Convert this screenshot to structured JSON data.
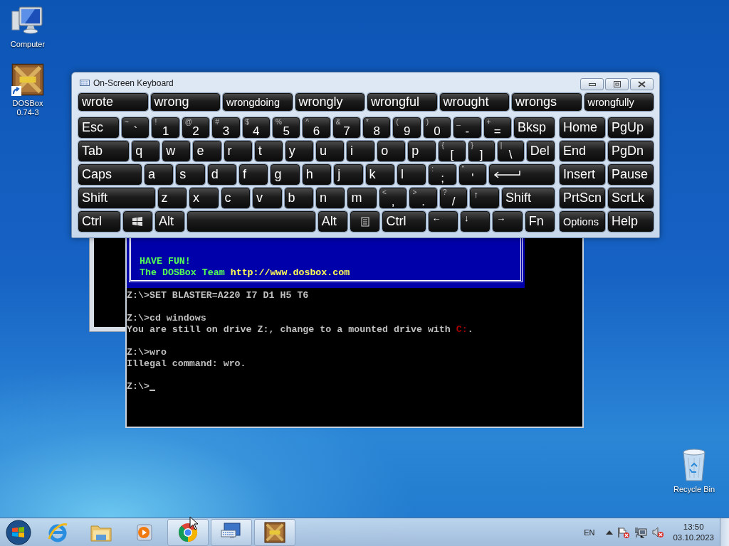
{
  "desktop_icons": [
    {
      "kind": "computer",
      "label": "Computer"
    },
    {
      "kind": "dosbox",
      "label": "DOSBox 0.74-3"
    }
  ],
  "recycle_bin": {
    "label": "Recycle Bin"
  },
  "dosbox_console": {
    "banner": [
      {
        "color": "#55ff55",
        "segments": [
          {
            "text": "HAVE FUN!"
          }
        ]
      },
      {
        "color": "#55ff55",
        "segments": [
          {
            "text": "The DOSBox Team "
          },
          {
            "text": "http://www.dosbox.com",
            "color": "#ffff55"
          }
        ]
      }
    ],
    "groups": [
      [
        {
          "color": "#c0c0c0",
          "segments": [
            {
              "text": "Z:\\>SET BLASTER=A220 I7 D1 H5 T6"
            }
          ]
        }
      ],
      [
        {
          "color": "#c0c0c0",
          "segments": [
            {
              "text": "Z:\\>cd windows"
            }
          ]
        },
        {
          "color": "#c0c0c0",
          "segments": [
            {
              "text": "You are still on drive Z:, change to a mounted drive with "
            },
            {
              "text": "C:",
              "color": "#aa0000"
            },
            {
              "text": "."
            }
          ]
        }
      ],
      [
        {
          "color": "#c0c0c0",
          "segments": [
            {
              "text": "Z:\\>wro"
            }
          ]
        },
        {
          "color": "#c0c0c0",
          "segments": [
            {
              "text": "Illegal command: wro."
            }
          ]
        }
      ],
      [
        {
          "color": "#c0c0c0",
          "segments": [
            {
              "text": "Z:\\>"
            }
          ]
        }
      ]
    ]
  },
  "keyboard": {
    "title": "On-Screen Keyboard",
    "predictions": [
      "wrote",
      "wrong",
      "wrongdoing",
      "wrongly",
      "wrongful",
      "wrought",
      "wrongs",
      "wrongfully"
    ],
    "key_rows": [
      {
        "keys": [
          {
            "kind": "text",
            "label": "Esc"
          },
          {
            "kind": "char",
            "shift": "~",
            "label": "`"
          },
          {
            "kind": "char",
            "shift": "!",
            "label": "1"
          },
          {
            "kind": "char",
            "shift": "@",
            "label": "2"
          },
          {
            "kind": "char",
            "shift": "#",
            "label": "3"
          },
          {
            "kind": "char",
            "shift": "$",
            "label": "4"
          },
          {
            "kind": "char",
            "shift": "%",
            "label": "5"
          },
          {
            "kind": "char",
            "shift": "^",
            "label": "6"
          },
          {
            "kind": "char",
            "shift": "&",
            "label": "7"
          },
          {
            "kind": "char",
            "shift": "*",
            "label": "8"
          },
          {
            "kind": "char",
            "shift": "(",
            "label": "9"
          },
          {
            "kind": "char",
            "shift": ")",
            "label": "0"
          },
          {
            "kind": "char",
            "shift": "_",
            "label": "-"
          },
          {
            "kind": "char",
            "shift": "+",
            "label": "="
          },
          {
            "kind": "text",
            "label": "Bksp"
          }
        ]
      },
      {
        "keys": [
          {
            "kind": "text",
            "label": "Tab"
          },
          {
            "kind": "text",
            "label": "q"
          },
          {
            "kind": "text",
            "label": "w"
          },
          {
            "kind": "text",
            "label": "e"
          },
          {
            "kind": "text",
            "label": "r"
          },
          {
            "kind": "text",
            "label": "t"
          },
          {
            "kind": "text",
            "label": "y"
          },
          {
            "kind": "text",
            "label": "u"
          },
          {
            "kind": "text",
            "label": "i"
          },
          {
            "kind": "text",
            "label": "o"
          },
          {
            "kind": "text",
            "label": "p"
          },
          {
            "kind": "char",
            "shift": "{",
            "label": "["
          },
          {
            "kind": "char",
            "shift": "}",
            "label": "]"
          },
          {
            "kind": "char",
            "shift": "|",
            "label": "\\"
          },
          {
            "kind": "text",
            "label": "Del"
          }
        ]
      },
      {
        "keys": [
          {
            "kind": "text",
            "label": "Caps"
          },
          {
            "kind": "text",
            "label": "a"
          },
          {
            "kind": "text",
            "label": "s"
          },
          {
            "kind": "text",
            "label": "d"
          },
          {
            "kind": "text",
            "label": "f"
          },
          {
            "kind": "text",
            "label": "g"
          },
          {
            "kind": "text",
            "label": "h"
          },
          {
            "kind": "text",
            "label": "j"
          },
          {
            "kind": "text",
            "label": "k"
          },
          {
            "kind": "text",
            "label": "l"
          },
          {
            "kind": "char",
            "shift": ":",
            "label": ";"
          },
          {
            "kind": "char",
            "shift": "\"",
            "label": "'"
          },
          {
            "kind": "enter"
          }
        ]
      },
      {
        "keys": [
          {
            "kind": "text",
            "label": "Shift"
          },
          {
            "kind": "text",
            "label": "z"
          },
          {
            "kind": "text",
            "label": "x"
          },
          {
            "kind": "text",
            "label": "c"
          },
          {
            "kind": "text",
            "label": "v"
          },
          {
            "kind": "text",
            "label": "b"
          },
          {
            "kind": "text",
            "label": "n"
          },
          {
            "kind": "text",
            "label": "m"
          },
          {
            "kind": "char",
            "shift": "<",
            "label": ","
          },
          {
            "kind": "char",
            "shift": ">",
            "label": "."
          },
          {
            "kind": "char",
            "shift": "?",
            "label": "/"
          },
          {
            "kind": "arrow",
            "label": "↑"
          },
          {
            "kind": "text",
            "label": "Shift"
          }
        ]
      },
      {
        "keys": [
          {
            "kind": "text",
            "label": "Ctrl"
          },
          {
            "kind": "windows"
          },
          {
            "kind": "text",
            "label": "Alt"
          },
          {
            "kind": "space"
          },
          {
            "kind": "text",
            "label": "Alt"
          },
          {
            "kind": "menu"
          },
          {
            "kind": "text",
            "label": "Ctrl"
          },
          {
            "kind": "arrow",
            "label": "←"
          },
          {
            "kind": "arrow",
            "label": "↓"
          },
          {
            "kind": "arrow",
            "label": "→"
          },
          {
            "kind": "text",
            "label": "Fn"
          }
        ]
      }
    ],
    "nav_rows": [
      [
        "Home",
        "PgUp"
      ],
      [
        "End",
        "PgDn"
      ],
      [
        "Insert",
        "Pause"
      ],
      [
        "PrtScn",
        "ScrLk"
      ],
      [
        "Options",
        "Help"
      ]
    ]
  },
  "taskbar": {
    "items": [
      {
        "kind": "ie",
        "running": false
      },
      {
        "kind": "explorer",
        "running": false
      },
      {
        "kind": "media",
        "running": false
      },
      {
        "kind": "chrome",
        "running": true
      },
      {
        "kind": "keyboard",
        "running": true
      },
      {
        "kind": "dosbox",
        "running": true
      }
    ],
    "language": "EN",
    "time": "13:50",
    "date": "03.10.2023"
  }
}
